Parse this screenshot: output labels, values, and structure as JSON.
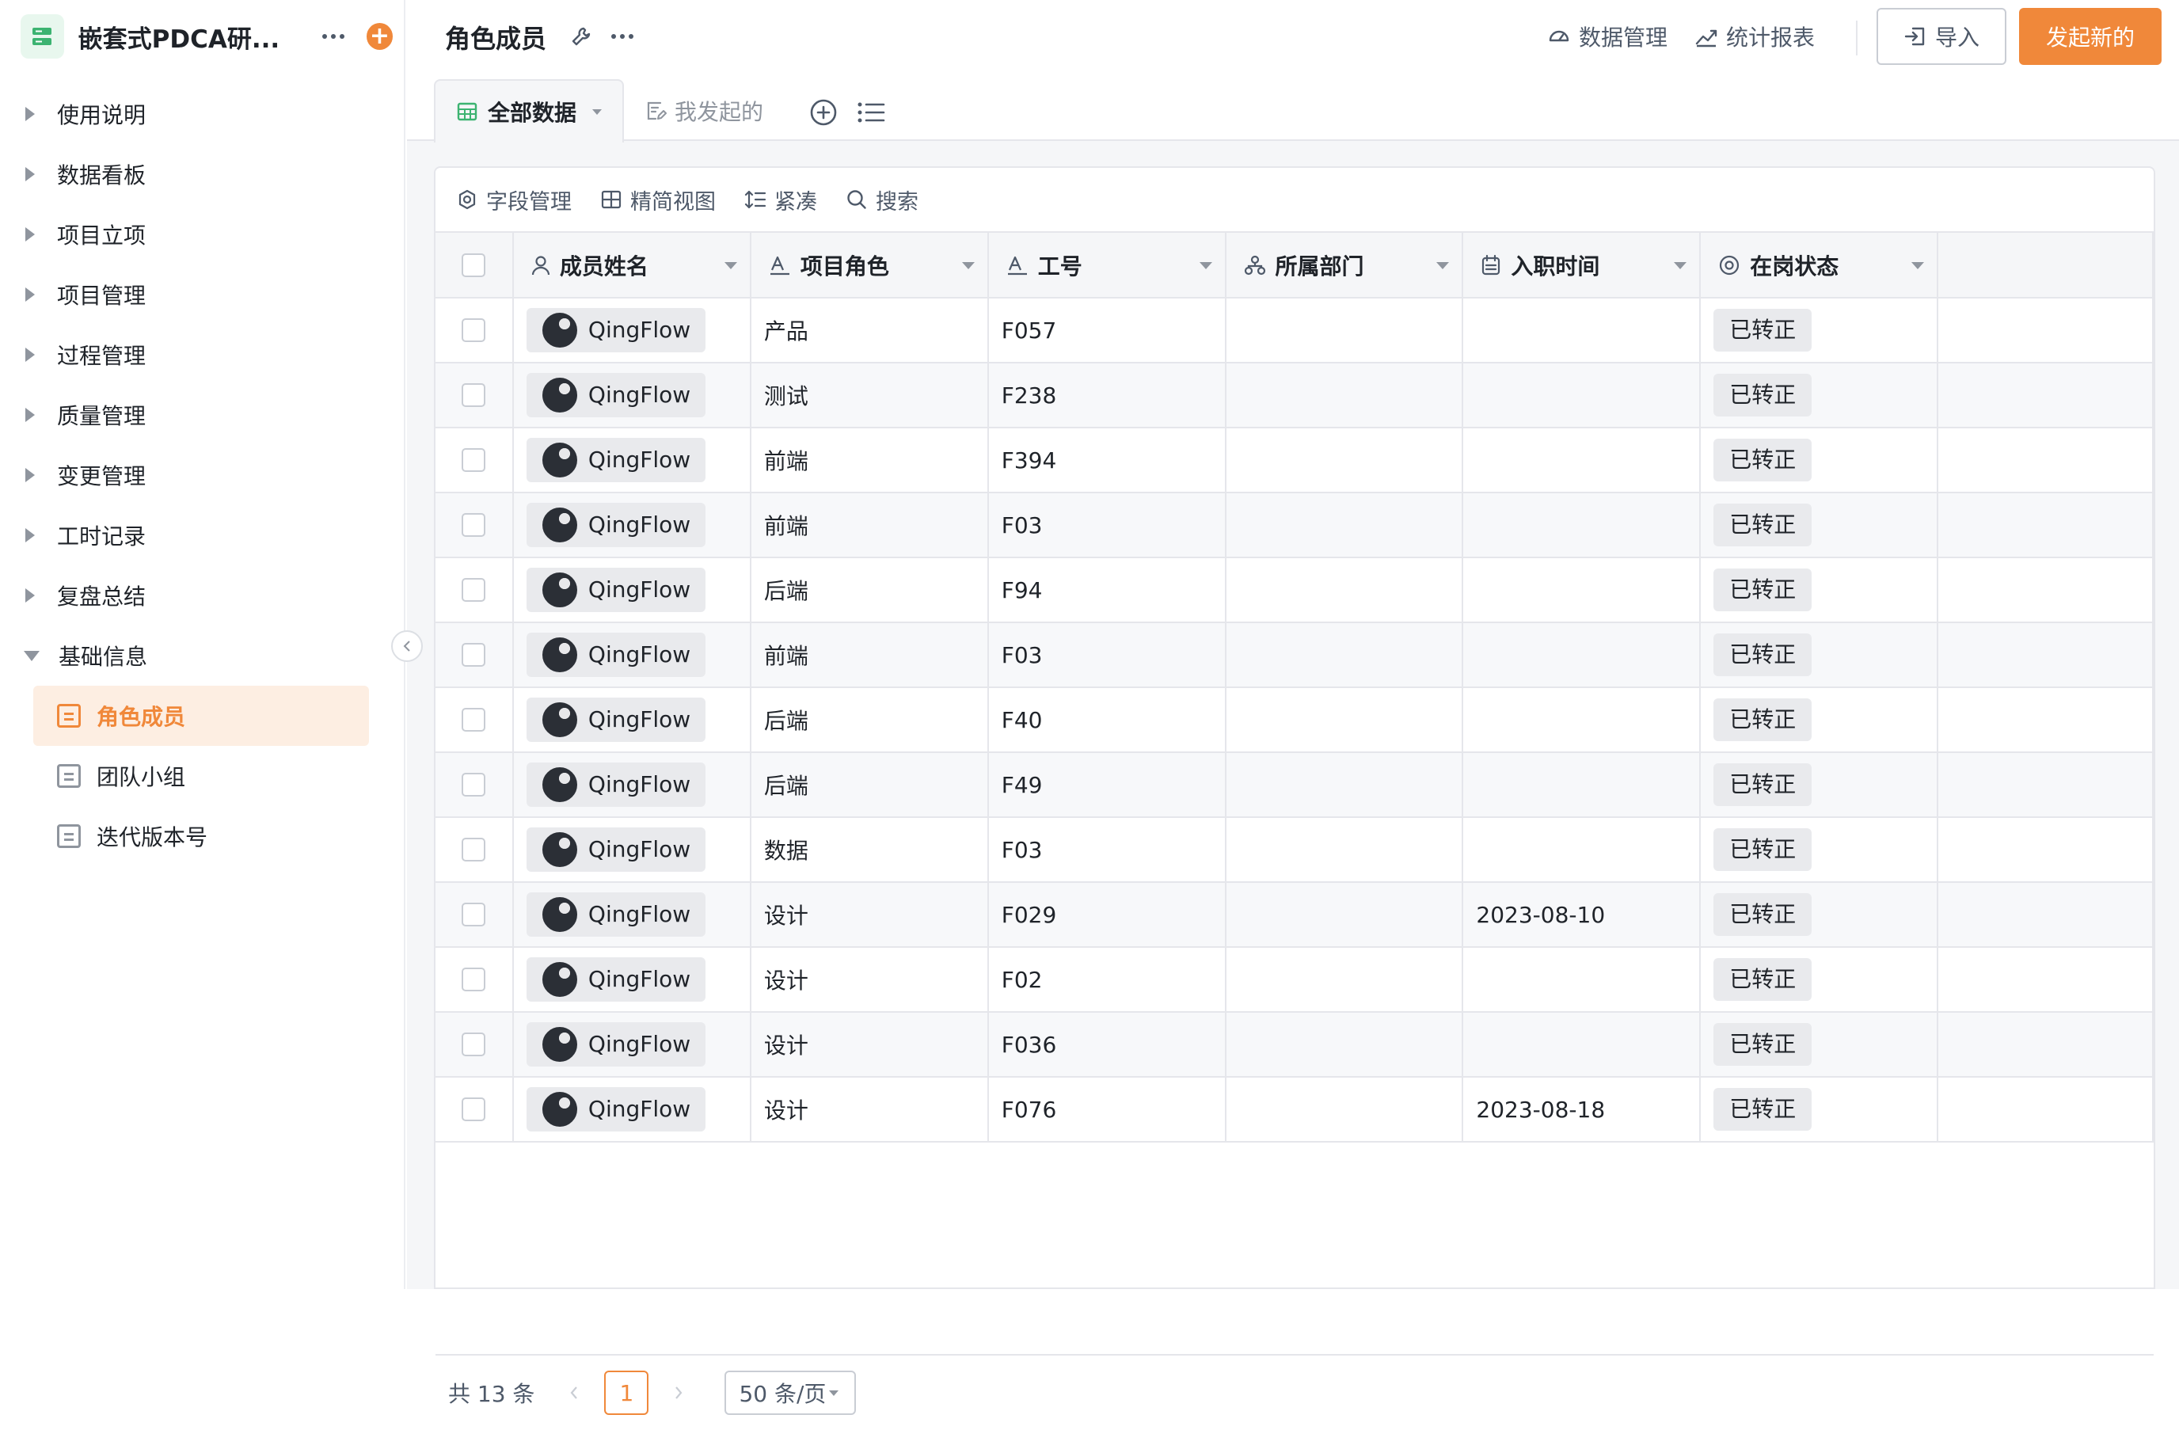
{
  "app": {
    "title": "嵌套式PDCA研...",
    "accent_color": "#f0883a"
  },
  "sidebar": {
    "items": [
      {
        "label": "使用说明",
        "expanded": false
      },
      {
        "label": "数据看板",
        "expanded": false
      },
      {
        "label": "项目立项",
        "expanded": false
      },
      {
        "label": "项目管理",
        "expanded": false
      },
      {
        "label": "过程管理",
        "expanded": false
      },
      {
        "label": "质量管理",
        "expanded": false
      },
      {
        "label": "变更管理",
        "expanded": false
      },
      {
        "label": "工时记录",
        "expanded": false
      },
      {
        "label": "复盘总结",
        "expanded": false
      },
      {
        "label": "基础信息",
        "expanded": true
      }
    ],
    "sub_items": [
      {
        "label": "角色成员",
        "active": true
      },
      {
        "label": "团队小组",
        "active": false
      },
      {
        "label": "迭代版本号",
        "active": false
      }
    ]
  },
  "header": {
    "page_title": "角色成员",
    "data_manage": "数据管理",
    "stats_report": "统计报表",
    "import_label": "导入",
    "new_label": "发起新的"
  },
  "tabs": {
    "all_data": "全部数据",
    "mine": "我发起的"
  },
  "toolbar": {
    "field_manage": "字段管理",
    "simple_view": "精简视图",
    "compact": "紧凑",
    "search": "搜索"
  },
  "table": {
    "columns": [
      "成员姓名",
      "项目角色",
      "工号",
      "所属部门",
      "入职时间",
      "在岗状态"
    ],
    "rows": [
      {
        "name": "QingFlow",
        "role": "产品",
        "id": "F057",
        "dept": "",
        "date": "",
        "status": "已转正"
      },
      {
        "name": "QingFlow",
        "role": "测试",
        "id": "F238",
        "dept": "",
        "date": "",
        "status": "已转正"
      },
      {
        "name": "QingFlow",
        "role": "前端",
        "id": "F394",
        "dept": "",
        "date": "",
        "status": "已转正"
      },
      {
        "name": "QingFlow",
        "role": "前端",
        "id": "F03",
        "dept": "",
        "date": "",
        "status": "已转正"
      },
      {
        "name": "QingFlow",
        "role": "后端",
        "id": "F94",
        "dept": "",
        "date": "",
        "status": "已转正"
      },
      {
        "name": "QingFlow",
        "role": "前端",
        "id": "F03",
        "dept": "",
        "date": "",
        "status": "已转正"
      },
      {
        "name": "QingFlow",
        "role": "后端",
        "id": "F40",
        "dept": "",
        "date": "",
        "status": "已转正"
      },
      {
        "name": "QingFlow",
        "role": "后端",
        "id": "F49",
        "dept": "",
        "date": "",
        "status": "已转正"
      },
      {
        "name": "QingFlow",
        "role": "数据",
        "id": "F03",
        "dept": "",
        "date": "",
        "status": "已转正"
      },
      {
        "name": "QingFlow",
        "role": "设计",
        "id": "F029",
        "dept": "",
        "date": "2023-08-10",
        "status": "已转正"
      },
      {
        "name": "QingFlow",
        "role": "设计",
        "id": "F02",
        "dept": "",
        "date": "",
        "status": "已转正"
      },
      {
        "name": "QingFlow",
        "role": "设计",
        "id": "F036",
        "dept": "",
        "date": "",
        "status": "已转正"
      },
      {
        "name": "QingFlow",
        "role": "设计",
        "id": "F076",
        "dept": "",
        "date": "2023-08-18",
        "status": "已转正"
      }
    ]
  },
  "pagination": {
    "total": "共 13 条",
    "current_page": "1",
    "page_size": "50 条/页"
  }
}
